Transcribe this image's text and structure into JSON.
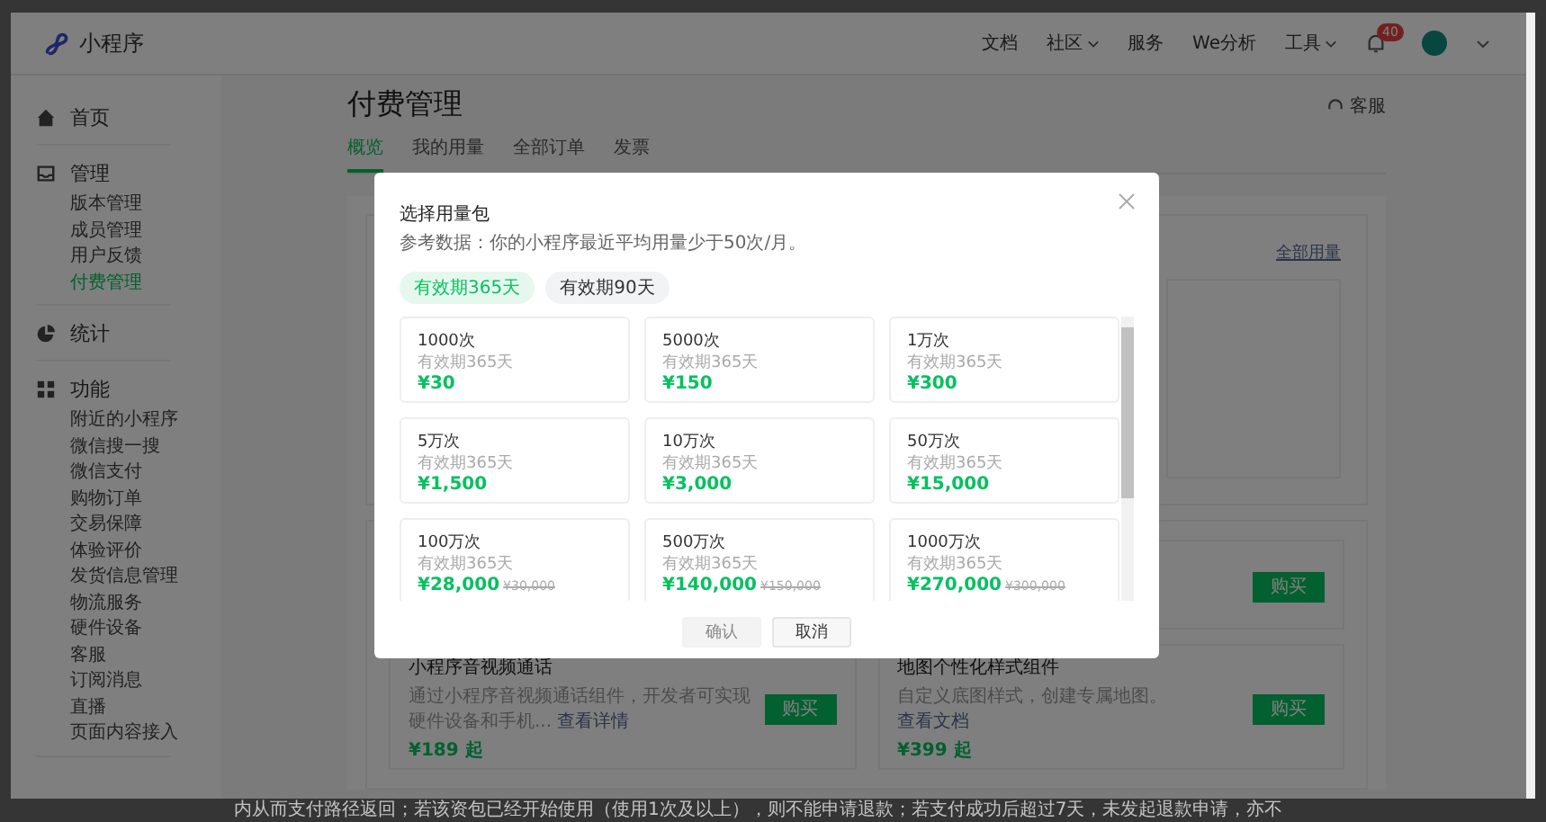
{
  "header": {
    "app_name": "小程序",
    "nav": [
      {
        "label": "文档",
        "dropdown": false
      },
      {
        "label": "社区",
        "dropdown": true
      },
      {
        "label": "服务",
        "dropdown": false
      },
      {
        "label": "We分析",
        "dropdown": false
      },
      {
        "label": "工具",
        "dropdown": true
      }
    ],
    "notification_count": "40"
  },
  "sidebar": [
    {
      "kind": "home",
      "label": "首页"
    },
    {
      "kind": "manage",
      "label": "管理",
      "items": [
        {
          "label": "版本管理",
          "selected": false
        },
        {
          "label": "成员管理",
          "selected": false
        },
        {
          "label": "用户反馈",
          "selected": false
        },
        {
          "label": "付费管理",
          "selected": true
        }
      ]
    },
    {
      "kind": "stats",
      "label": "统计"
    },
    {
      "kind": "features",
      "label": "功能",
      "items": [
        {
          "label": "附近的小程序",
          "selected": false
        },
        {
          "label": "微信搜一搜",
          "selected": false
        },
        {
          "label": "微信支付",
          "selected": false
        },
        {
          "label": "购物订单",
          "selected": false
        },
        {
          "label": "交易保障",
          "selected": false
        },
        {
          "label": "体验评价",
          "selected": false
        },
        {
          "label": "发货信息管理",
          "selected": false
        },
        {
          "label": "物流服务",
          "selected": false
        },
        {
          "label": "硬件设备",
          "selected": false
        },
        {
          "label": "客服",
          "selected": false
        },
        {
          "label": "订阅消息",
          "selected": false
        },
        {
          "label": "直播",
          "selected": false
        },
        {
          "label": "页面内容接入",
          "selected": false
        }
      ]
    }
  ],
  "page": {
    "title": "付费管理",
    "support": "客服",
    "tabs": [
      {
        "label": "概览",
        "selected": true
      },
      {
        "label": "我的用量",
        "selected": false
      },
      {
        "label": "全部订单",
        "selected": false
      },
      {
        "label": "发票",
        "selected": false
      }
    ],
    "all_usage_link": "全部用量"
  },
  "services": [
    {
      "buy": "购买"
    },
    {
      "title": "小程序音视频通话",
      "description": "通过小程序音视频通话组件，开发者可实现硬件设备和手机...",
      "link": "查看详情",
      "price": "¥189 起",
      "buy": "购买"
    },
    {
      "title": "地图个性化样式组件",
      "description": "自定义底图样式，创建专属地图。",
      "link": "查看文档",
      "price": "¥399 起",
      "buy": "购买"
    }
  ],
  "modal": {
    "title": "选择用量包",
    "subtitle": "参考数据：你的小程序最近平均用量少于50次/月。",
    "periods": [
      {
        "label": "有效期365天",
        "selected": true
      },
      {
        "label": "有效期90天",
        "selected": false
      }
    ],
    "packages": [
      {
        "name": "1000次",
        "validity": "有效期365天",
        "price": "¥30"
      },
      {
        "name": "5000次",
        "validity": "有效期365天",
        "price": "¥150"
      },
      {
        "name": "1万次",
        "validity": "有效期365天",
        "price": "¥300"
      },
      {
        "name": "5万次",
        "validity": "有效期365天",
        "price": "¥1,500"
      },
      {
        "name": "10万次",
        "validity": "有效期365天",
        "price": "¥3,000"
      },
      {
        "name": "50万次",
        "validity": "有效期365天",
        "price": "¥15,000"
      },
      {
        "name": "100万次",
        "validity": "有效期365天",
        "price": "¥28,000",
        "original_price": "¥30,000"
      },
      {
        "name": "500万次",
        "validity": "有效期365天",
        "price": "¥140,000",
        "original_price": "¥150,000"
      },
      {
        "name": "1000万次",
        "validity": "有效期365天",
        "price": "¥270,000",
        "original_price": "¥300,000"
      }
    ],
    "confirm": {
      "label": "确认",
      "disabled": true
    },
    "cancel": "取消"
  },
  "footer_text": "内从而支付路径返回；若该资包已经开始使用（使用1次及以上），则不能申请退款；若支付成功后超过7天，未发起退款申请，亦不"
}
